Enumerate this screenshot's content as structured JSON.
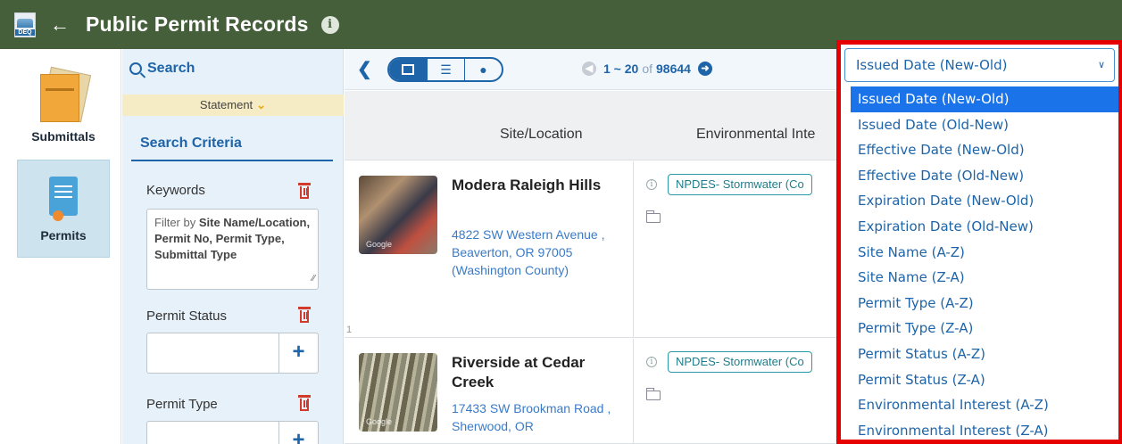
{
  "header": {
    "logo_text": "DEQ",
    "title": "Public Permit Records"
  },
  "leftnav": {
    "items": [
      {
        "label": "Submittals"
      },
      {
        "label": "Permits"
      }
    ]
  },
  "filter": {
    "search_label": "Search",
    "statement_label": "Statement",
    "criteria_tab": "Search Criteria",
    "keywords_label": "Keywords",
    "keywords_placeholder_prefix": "Filter by ",
    "keywords_placeholder_bold": "Site Name/Location, Permit No, Permit Type, Submittal Type",
    "permit_status_label": "Permit Status",
    "permit_type_label": "Permit Type"
  },
  "toolbar": {
    "pager_range": "1 ~ 20",
    "pager_of": "of",
    "pager_total": "98644"
  },
  "table": {
    "headers": [
      "Site/Location",
      "Environmental Inte"
    ],
    "rows": [
      {
        "num": "1",
        "thumb_watermark": "Google",
        "site_name": "Modera Raleigh Hills",
        "address": "4822 SW Western Avenue , Beaverton, OR 97005 (Washington County)",
        "env_tag": "NPDES- Stormwater (Co"
      },
      {
        "num": "",
        "thumb_watermark": "Google",
        "site_name": "Riverside at Cedar Creek",
        "address": "17433 SW Brookman Road , Sherwood, OR",
        "env_tag": "NPDES- Stormwater (Co"
      }
    ]
  },
  "sort": {
    "selected": "Issued Date (New-Old)",
    "options": [
      "Issued Date (New-Old)",
      "Issued Date (Old-New)",
      "Effective Date (New-Old)",
      "Effective Date (Old-New)",
      "Expiration Date (New-Old)",
      "Expiration Date (Old-New)",
      "Site Name (A-Z)",
      "Site Name (Z-A)",
      "Permit Type (A-Z)",
      "Permit Type (Z-A)",
      "Permit Status (A-Z)",
      "Permit Status (Z-A)",
      "Environmental Interest (A-Z)",
      "Environmental Interest (Z-A)"
    ]
  },
  "colors": {
    "header_bg": "#445f3a",
    "accent": "#1e64a8",
    "highlight_frame": "#e60000",
    "selected_option": "#1a73e8"
  }
}
